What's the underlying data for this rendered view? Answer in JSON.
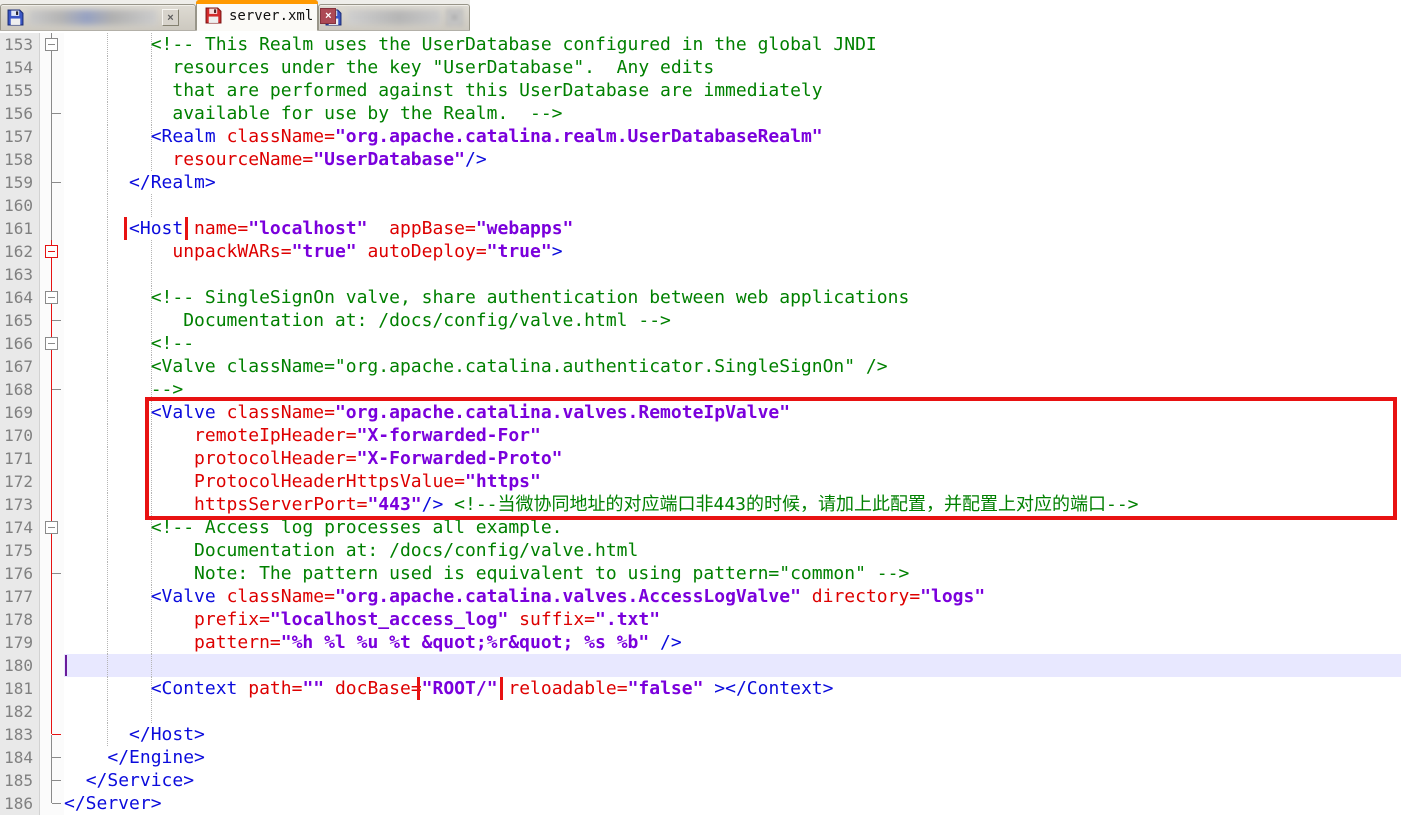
{
  "tab_bar": {
    "close_glyph": "×",
    "active_accent_color": "#ff9900",
    "tabs": [
      {
        "label": "",
        "redacted": true,
        "modified": false,
        "active": false
      },
      {
        "label": "server.xml",
        "redacted": false,
        "modified": true,
        "active": true
      },
      {
        "label": "",
        "redacted": true,
        "modified": false,
        "active": false
      }
    ]
  },
  "colors": {
    "tag": "#0b0bdc",
    "attribute": "#dd0000",
    "value": "#7a00dc",
    "comment": "#008000",
    "annotation_red": "#e81212",
    "current_line_bg": "#e8e8ff",
    "fold_scope_highlight": "#e51212"
  },
  "annotations": [
    {
      "shape": "box",
      "around": "<Host"
    },
    {
      "shape": "box",
      "around": "RemoteIpValve block, lines 169-173"
    },
    {
      "shape": "box",
      "around": "\"ROOT/\""
    }
  ],
  "editor": {
    "first_line": 153,
    "last_line": 186,
    "current_line": 180,
    "lines": [
      {
        "n": 153,
        "f": "box",
        "t": [
          [
            "c",
            "        <!-- This Realm uses the UserDatabase configured in the global JNDI"
          ]
        ]
      },
      {
        "n": 154,
        "f": "line",
        "t": [
          [
            "c",
            "          resources under the key \"UserDatabase\".  Any edits"
          ]
        ]
      },
      {
        "n": 155,
        "f": "line",
        "t": [
          [
            "c",
            "          that are performed against this UserDatabase are immediately"
          ]
        ]
      },
      {
        "n": 156,
        "f": "tick",
        "t": [
          [
            "c",
            "          available for use by the Realm.  -->"
          ]
        ]
      },
      {
        "n": 157,
        "f": "line",
        "t": [
          [
            "p",
            "        "
          ],
          [
            "t",
            "<Realm"
          ],
          [
            "a",
            " className="
          ],
          [
            "v",
            "\"org.apache.catalina.realm.UserDatabaseRealm\""
          ]
        ]
      },
      {
        "n": 158,
        "f": "line",
        "t": [
          [
            "p",
            "          "
          ],
          [
            "a",
            "resourceName="
          ],
          [
            "v",
            "\"UserDatabase\""
          ],
          [
            "t",
            "/>"
          ]
        ]
      },
      {
        "n": 159,
        "f": "tick",
        "t": [
          [
            "p",
            "      "
          ],
          [
            "t",
            "</Realm>"
          ]
        ]
      },
      {
        "n": 160,
        "f": "line",
        "t": []
      },
      {
        "n": 161,
        "f": "line",
        "t": [
          [
            "p",
            "      "
          ],
          [
            "t",
            "<Host",
            "box"
          ],
          [
            "a",
            " name="
          ],
          [
            "v",
            "\"localhost\""
          ],
          [
            "a",
            "  appBase="
          ],
          [
            "v",
            "\"webapps\""
          ]
        ]
      },
      {
        "n": 162,
        "f": "boxred",
        "t": [
          [
            "p",
            "          "
          ],
          [
            "a",
            "unpackWARs="
          ],
          [
            "v",
            "\"true\""
          ],
          [
            "a",
            " autoDeploy="
          ],
          [
            "v",
            "\"true\""
          ],
          [
            "t",
            ">"
          ]
        ]
      },
      {
        "n": 163,
        "f": "lineR",
        "t": []
      },
      {
        "n": 164,
        "f": "boxR",
        "t": [
          [
            "c",
            "        <!-- SingleSignOn valve, share authentication between web applications"
          ]
        ]
      },
      {
        "n": 165,
        "f": "tickR",
        "t": [
          [
            "c",
            "           Documentation at: /docs/config/valve.html -->"
          ]
        ]
      },
      {
        "n": 166,
        "f": "boxR",
        "t": [
          [
            "c",
            "        <!--"
          ]
        ]
      },
      {
        "n": 167,
        "f": "lineR",
        "t": [
          [
            "c",
            "        <Valve className=\"org.apache.catalina.authenticator.SingleSignOn\" />"
          ]
        ]
      },
      {
        "n": 168,
        "f": "tickR",
        "t": [
          [
            "c",
            "        -->"
          ]
        ]
      },
      {
        "n": 169,
        "f": "lineR",
        "t": [
          [
            "p",
            "        "
          ],
          [
            "t",
            "<Valve"
          ],
          [
            "a",
            " className="
          ],
          [
            "v",
            "\"org.apache.catalina.valves.RemoteIpValve\""
          ]
        ]
      },
      {
        "n": 170,
        "f": "lineR",
        "t": [
          [
            "p",
            "            "
          ],
          [
            "a",
            "remoteIpHeader="
          ],
          [
            "v",
            "\"X-forwarded-For\""
          ]
        ]
      },
      {
        "n": 171,
        "f": "lineR",
        "t": [
          [
            "p",
            "            "
          ],
          [
            "a",
            "protocolHeader="
          ],
          [
            "v",
            "\"X-Forwarded-Proto\""
          ]
        ]
      },
      {
        "n": 172,
        "f": "lineR",
        "t": [
          [
            "p",
            "            "
          ],
          [
            "a",
            "ProtocolHeaderHttpsValue="
          ],
          [
            "v",
            "\"https\""
          ]
        ]
      },
      {
        "n": 173,
        "f": "lineR",
        "t": [
          [
            "p",
            "            "
          ],
          [
            "a",
            "httpsServerPort="
          ],
          [
            "v",
            "\"443\""
          ],
          [
            "t",
            "/>"
          ],
          [
            "p",
            " "
          ],
          [
            "c",
            "<!--当微协同地址的对应端口非443的时候，请加上此配置，并配置上对应的端口-->"
          ]
        ]
      },
      {
        "n": 174,
        "f": "boxR",
        "t": [
          [
            "c",
            "        <!-- Access log processes all example."
          ]
        ]
      },
      {
        "n": 175,
        "f": "lineR",
        "t": [
          [
            "c",
            "            Documentation at: /docs/config/valve.html"
          ]
        ]
      },
      {
        "n": 176,
        "f": "tickR",
        "t": [
          [
            "c",
            "            Note: The pattern used is equivalent to using pattern=\"common\" -->"
          ]
        ]
      },
      {
        "n": 177,
        "f": "lineR",
        "t": [
          [
            "p",
            "        "
          ],
          [
            "t",
            "<Valve"
          ],
          [
            "a",
            " className="
          ],
          [
            "v",
            "\"org.apache.catalina.valves.AccessLogValve\""
          ],
          [
            "a",
            " directory="
          ],
          [
            "v",
            "\"logs\""
          ]
        ]
      },
      {
        "n": 178,
        "f": "lineR",
        "t": [
          [
            "p",
            "            "
          ],
          [
            "a",
            "prefix="
          ],
          [
            "v",
            "\"localhost_access_log\""
          ],
          [
            "a",
            " suffix="
          ],
          [
            "v",
            "\".txt\""
          ]
        ]
      },
      {
        "n": 179,
        "f": "lineR",
        "t": [
          [
            "p",
            "            "
          ],
          [
            "a",
            "pattern="
          ],
          [
            "v",
            "\"%h %l %u %t &quot;%r&quot; %s %b\""
          ],
          [
            "t",
            " />"
          ]
        ]
      },
      {
        "n": 180,
        "f": "lineR",
        "t": []
      },
      {
        "n": 181,
        "f": "lineR",
        "t": [
          [
            "p",
            "        "
          ],
          [
            "t",
            "<Context"
          ],
          [
            "a",
            " path="
          ],
          [
            "v",
            "\"\""
          ],
          [
            "a",
            " docBase="
          ],
          [
            "v",
            "\"ROOT/\"",
            "box"
          ],
          [
            "a",
            " reloadable="
          ],
          [
            "v",
            "\"false\""
          ],
          [
            "t",
            " ></Context>"
          ]
        ]
      },
      {
        "n": 182,
        "f": "lineR",
        "t": []
      },
      {
        "n": 183,
        "f": "cornerR",
        "t": [
          [
            "p",
            "      "
          ],
          [
            "t",
            "</Host>"
          ]
        ]
      },
      {
        "n": 184,
        "f": "tick",
        "t": [
          [
            "p",
            "    "
          ],
          [
            "t",
            "</Engine>"
          ]
        ]
      },
      {
        "n": 185,
        "f": "tick",
        "t": [
          [
            "p",
            "  "
          ],
          [
            "t",
            "</Service>"
          ]
        ]
      },
      {
        "n": 186,
        "f": "corner",
        "t": [
          [
            "t",
            "</Server>"
          ]
        ]
      }
    ]
  }
}
